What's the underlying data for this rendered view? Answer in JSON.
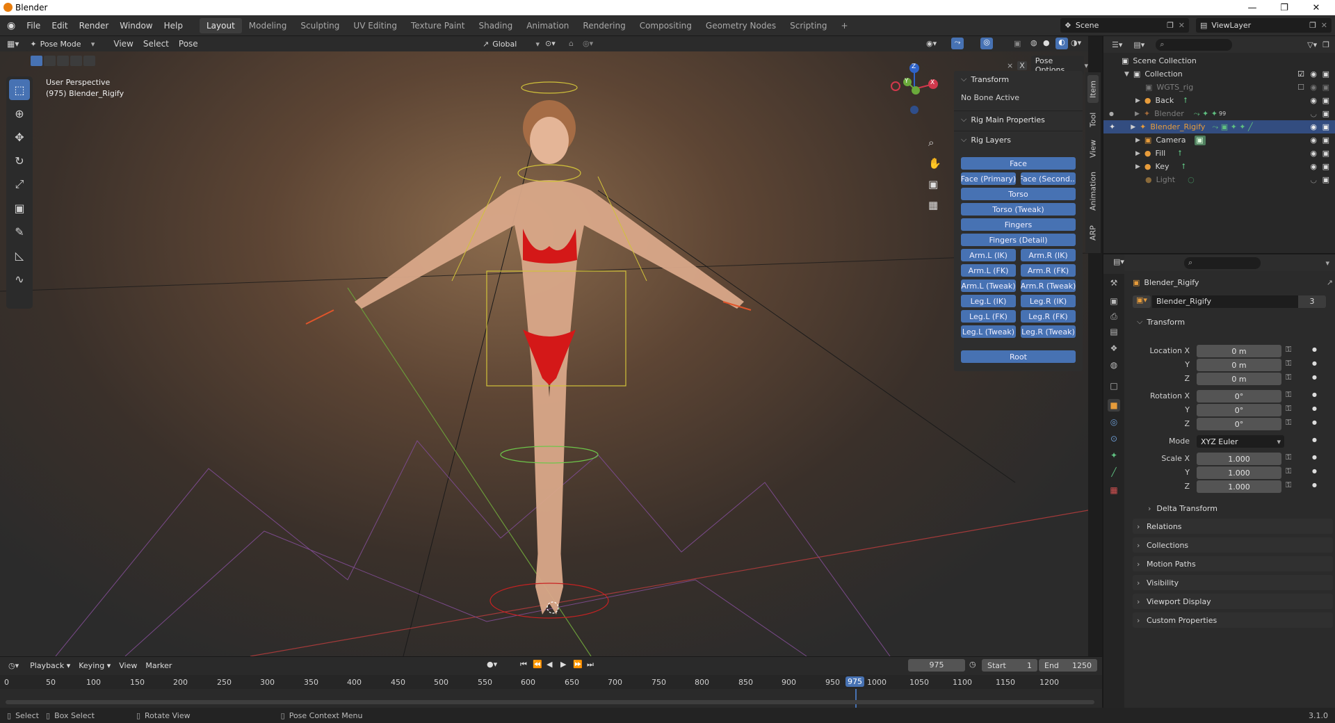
{
  "window": {
    "title": "Blender"
  },
  "menu": [
    "File",
    "Edit",
    "Render",
    "Window",
    "Help"
  ],
  "workspaces": [
    {
      "label": "Layout",
      "active": true
    },
    {
      "label": "Modeling"
    },
    {
      "label": "Sculpting"
    },
    {
      "label": "UV Editing"
    },
    {
      "label": "Texture Paint"
    },
    {
      "label": "Shading"
    },
    {
      "label": "Animation"
    },
    {
      "label": "Rendering"
    },
    {
      "label": "Compositing"
    },
    {
      "label": "Geometry Nodes"
    },
    {
      "label": "Scripting"
    }
  ],
  "add_workspace": "+",
  "scene": {
    "name": "Scene",
    "view_layer": "ViewLayer"
  },
  "viewport_header": {
    "mode": "Pose Mode",
    "menus": [
      "View",
      "Select",
      "Pose"
    ],
    "orientation": "Global",
    "pose_options": "Pose Options"
  },
  "viewport": {
    "perspective": "User Perspective",
    "object_info": "(975) Blender_Rigify",
    "gizmo_axes": [
      "X",
      "Y",
      "Z"
    ]
  },
  "npanel": {
    "tabs": [
      "Item",
      "Tool",
      "View",
      "Animation",
      "ARP"
    ],
    "transform_title": "Transform",
    "no_bone": "No Bone Active",
    "rig_main": "Rig Main Properties",
    "rig_layers": "Rig Layers",
    "layers": {
      "face": "Face",
      "face_primary": "Face (Primary)",
      "face_secondary": "Face (Second...",
      "torso": "Torso",
      "torso_tweak": "Torso (Tweak)",
      "fingers": "Fingers",
      "fingers_detail": "Fingers (Detail)",
      "arm_l_ik": "Arm.L (IK)",
      "arm_r_ik": "Arm.R (IK)",
      "arm_l_fk": "Arm.L (FK)",
      "arm_r_fk": "Arm.R (FK)",
      "arm_l_tweak": "Arm.L (Tweak)",
      "arm_r_tweak": "Arm.R (Tweak)",
      "leg_l_ik": "Leg.L (IK)",
      "leg_r_ik": "Leg.R (IK)",
      "leg_l_fk": "Leg.L (FK)",
      "leg_r_fk": "Leg.R (FK)",
      "leg_l_tweak": "Leg.L (Tweak)",
      "leg_r_tweak": "Leg.R (Tweak)",
      "root": "Root"
    }
  },
  "outliner": {
    "scene_collection": "Scene Collection",
    "items": [
      {
        "label": "Collection",
        "depth": 1
      },
      {
        "label": "WGTS_rig",
        "depth": 2,
        "dim": true
      },
      {
        "label": "Back",
        "depth": 2
      },
      {
        "label": "Blender",
        "depth": 2,
        "dim": true,
        "badge": "99"
      },
      {
        "label": "Blender_Rigify",
        "depth": 2,
        "selected": true
      },
      {
        "label": "Camera",
        "depth": 2
      },
      {
        "label": "Fill",
        "depth": 2
      },
      {
        "label": "Key",
        "depth": 2
      },
      {
        "label": "Light",
        "depth": 2,
        "dim": true
      }
    ]
  },
  "properties": {
    "object_name": "Blender_Rigify",
    "data_name": "Blender_Rigify",
    "users": "3",
    "transform": "Transform",
    "location_x_label": "Location X",
    "rotation_x_label": "Rotation X",
    "scale_x_label": "Scale X",
    "y_label": "Y",
    "z_label": "Z",
    "mode_label": "Mode",
    "location": [
      "0 m",
      "0 m",
      "0 m"
    ],
    "rotation": [
      "0°",
      "0°",
      "0°"
    ],
    "rotation_mode": "XYZ Euler",
    "scale": [
      "1.000",
      "1.000",
      "1.000"
    ],
    "delta_transform": "Delta Transform",
    "sections": [
      "Relations",
      "Collections",
      "Motion Paths",
      "Visibility",
      "Viewport Display",
      "Custom Properties"
    ]
  },
  "timeline": {
    "menus": [
      "Playback",
      "Keying",
      "View",
      "Marker"
    ],
    "current_frame": "975",
    "start_label": "Start",
    "start": "1",
    "end_label": "End",
    "end": "1250",
    "ticks": [
      "0",
      "50",
      "100",
      "150",
      "200",
      "250",
      "300",
      "350",
      "400",
      "450",
      "500",
      "550",
      "600",
      "650",
      "700",
      "750",
      "800",
      "850",
      "900",
      "950",
      "975",
      "1000",
      "1050",
      "1100",
      "1150",
      "1200"
    ]
  },
  "status": {
    "select": "Select",
    "box_select": "Box Select",
    "rotate_view": "Rotate View",
    "context_menu": "Pose Context Menu",
    "version": "3.1.0"
  },
  "colors": {
    "accent": "#4772b3",
    "selected_row": "#334d80",
    "playhead": "#4772b3"
  }
}
